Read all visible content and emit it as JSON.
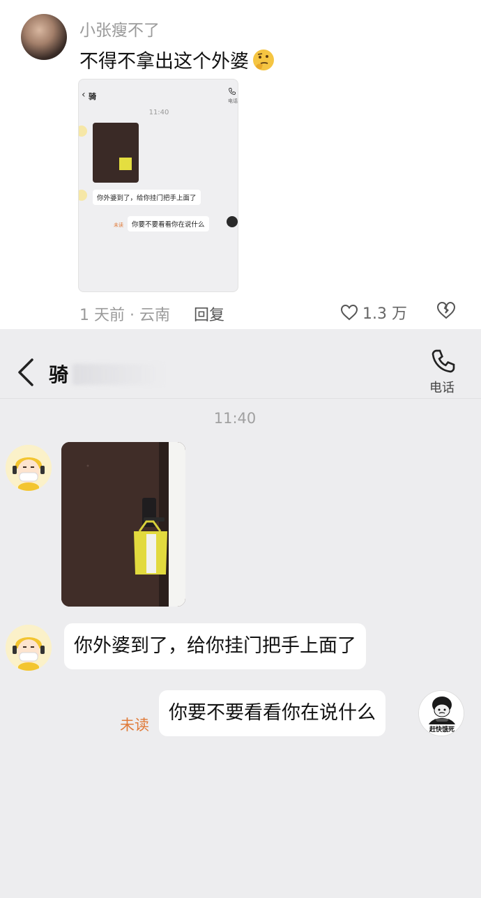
{
  "comment": {
    "username": "小张瘦不了",
    "text": "不得不拿出这个外婆",
    "emoji_icon": "thinking-face-icon",
    "meta": "1 天前 · 云南",
    "reply_label": "回复",
    "like_count": "1.3 万"
  },
  "thumbnail": {
    "title": "骑",
    "phone_label": "电话",
    "time": "11:40",
    "msg_in": "你外婆到了，给你挂门把手上面了",
    "unread": "未读",
    "msg_out": "你要不要看看你在说什么"
  },
  "chat": {
    "title": "骑",
    "phone_label": "电话",
    "time": "11:40",
    "msg_in": "你外婆到了，给你挂门把手上面了",
    "unread": "未读",
    "msg_out": "你要不要看看你在说什么",
    "my_avatar_caption": "赶快饿死"
  },
  "colors": {
    "chat_bg": "#ededef",
    "unread": "#e07b3a",
    "bag_yellow": "#e4de40"
  }
}
